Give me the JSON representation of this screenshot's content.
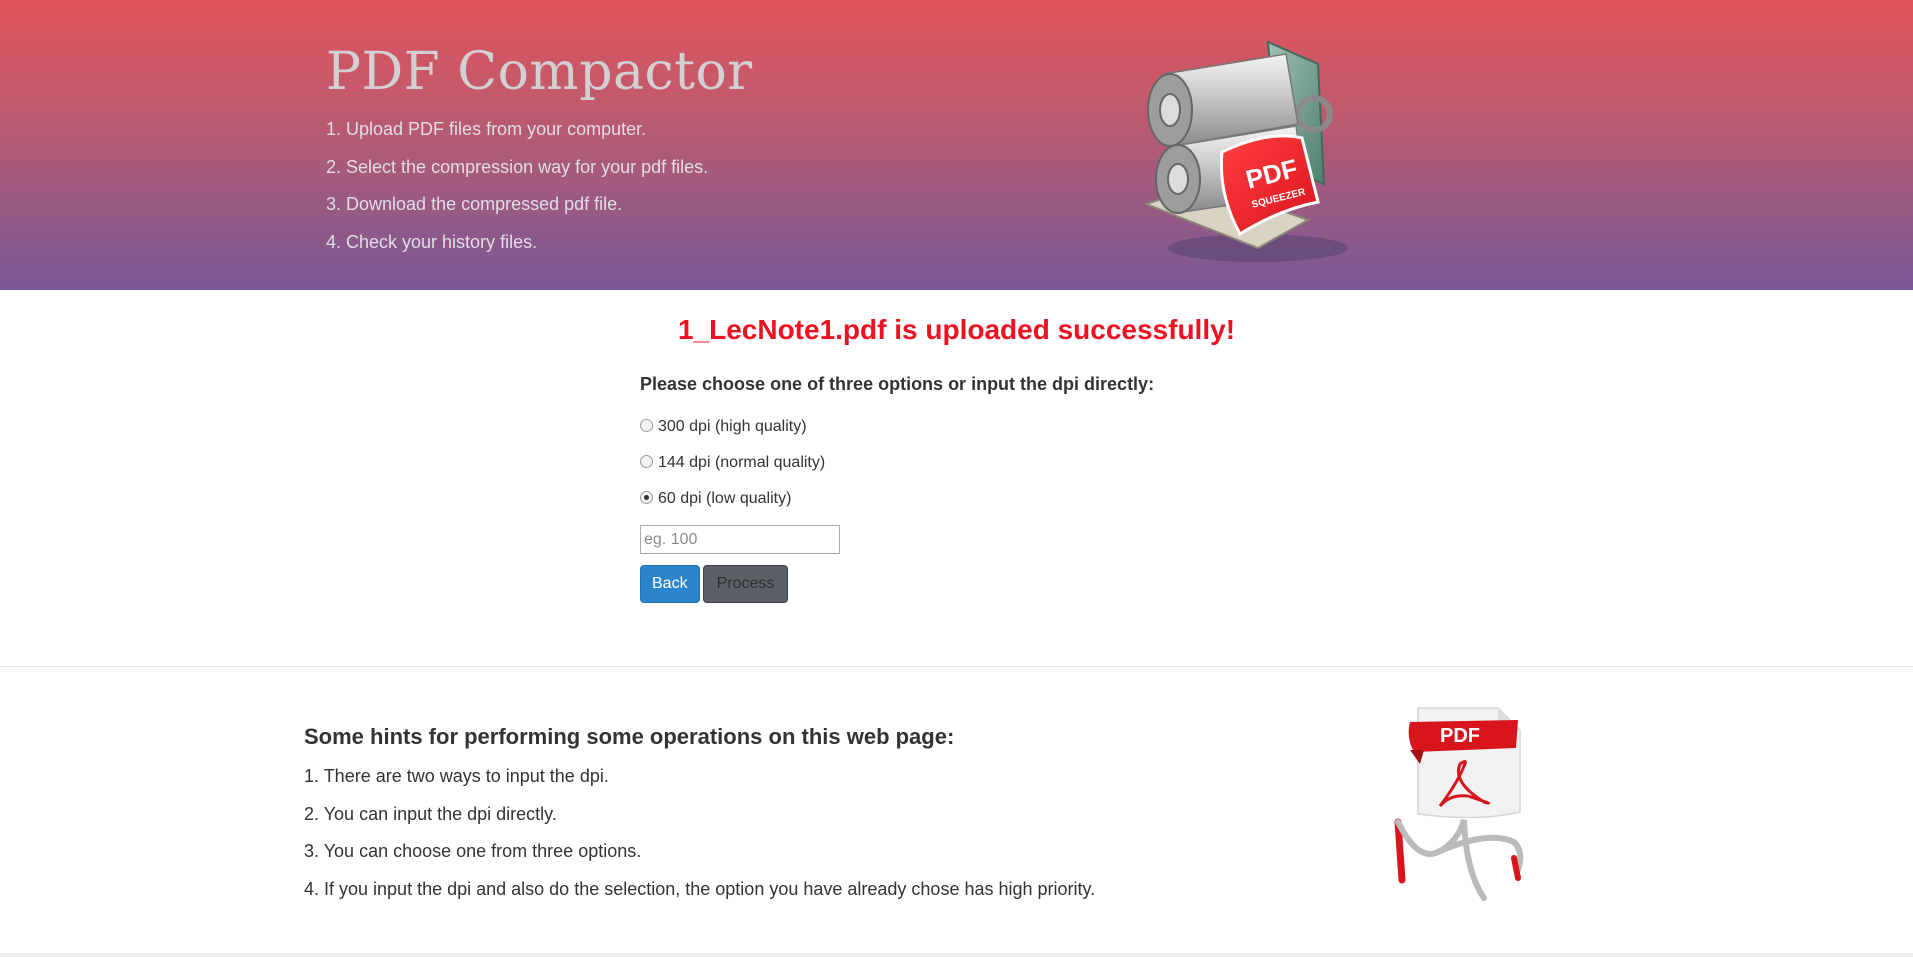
{
  "header": {
    "title": "PDF Compactor",
    "steps": [
      "1. Upload PDF files from your computer.",
      "2. Select the compression way for your pdf files.",
      "3. Download the compressed pdf file.",
      "4. Check your history files."
    ],
    "illustration": {
      "icon": "pdf-squeezer-icon",
      "label": "PDF",
      "sublabel": "SQUEEZER"
    }
  },
  "main": {
    "upload_message": "1_LecNote1.pdf is uploaded successfully!",
    "prompt": "Please choose one of three options or input the dpi directly:",
    "options": [
      {
        "label": "300 dpi (high quality)",
        "checked": false
      },
      {
        "label": "144 dpi (normal quality)",
        "checked": false
      },
      {
        "label": "60 dpi (low quality)",
        "checked": true
      }
    ],
    "dpi_input": {
      "value": "",
      "placeholder": "eg. 100"
    },
    "back_label": "Back",
    "process_label": "Process"
  },
  "hints": {
    "title": "Some hints for performing some operations on this web page:",
    "items": [
      "1. There are two ways to input the dpi.",
      "2. You can input the dpi directly.",
      "3. You can choose one from three options.",
      "4. If you input the dpi and also do the selection, the option you have already chose has high priority."
    ],
    "logo": {
      "icon": "adobe-pdf-icon",
      "label": "PDF"
    }
  },
  "colors": {
    "header_top": "#e0525a",
    "header_bottom": "#785897",
    "success_text": "#ee1122",
    "back_button": "#2a85cc",
    "process_button": "#5b6067"
  }
}
